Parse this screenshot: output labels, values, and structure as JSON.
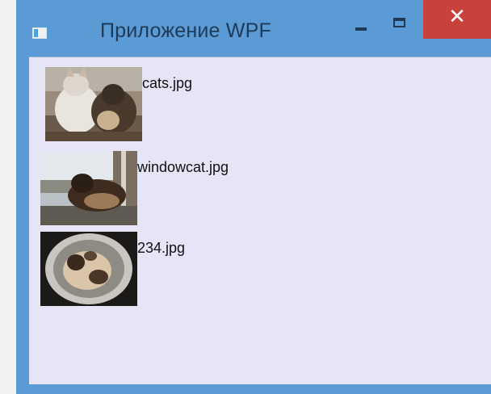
{
  "window": {
    "title": "Приложение WPF",
    "close_glyph": "✕",
    "accent_color": "#5b9bd5",
    "close_color": "#c8413b",
    "client_background": "#e6e4f7"
  },
  "icons": {
    "app": "app-icon",
    "minimize": "minimize-icon",
    "maximize": "maximize-icon",
    "close": "close-icon"
  },
  "files": [
    {
      "name": "cats.jpg"
    },
    {
      "name": "windowcat.jpg"
    },
    {
      "name": "234.jpg"
    }
  ]
}
